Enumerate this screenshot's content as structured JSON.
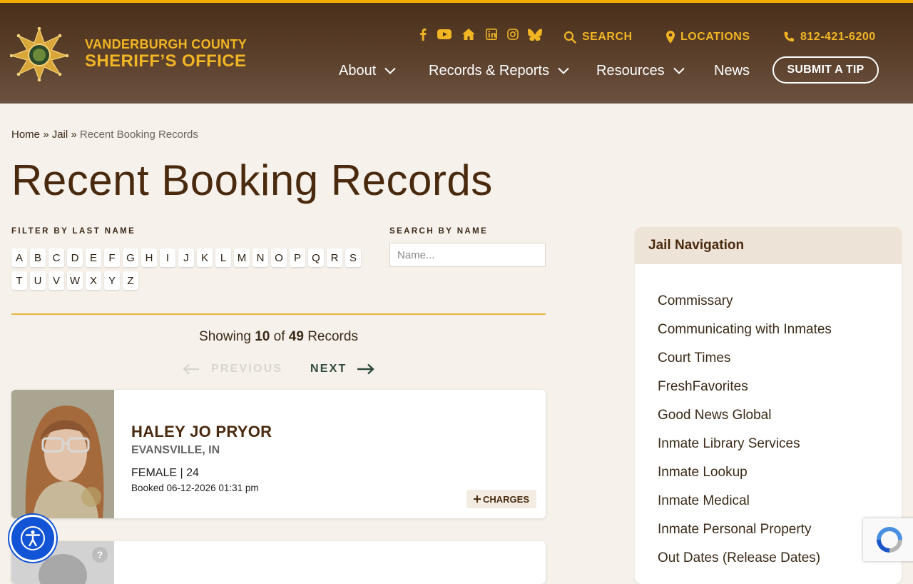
{
  "site": {
    "brand_line1": "VANDERBURGH COUNTY",
    "brand_line2": "SHERIFF’S OFFICE",
    "accent": "#f2b524",
    "header_bg": "#4a2f1b"
  },
  "social_icons": [
    "facebook-icon",
    "youtube-icon",
    "home-icon",
    "linkedin-icon",
    "instagram-icon",
    "bluesky-icon"
  ],
  "utility": {
    "search_label": "SEARCH",
    "locations_label": "LOCATIONS",
    "phone": "812-421-6200"
  },
  "nav": {
    "about": "About",
    "records": "Records & Reports",
    "resources": "Resources",
    "news": "News",
    "tip": "SUBMIT A TIP"
  },
  "breadcrumb": {
    "home": "Home",
    "sep1": "»",
    "jail": "Jail",
    "sep2": "»",
    "current": "Recent Booking Records"
  },
  "page_title": "Recent Booking Records",
  "filter": {
    "label": "FILTER BY LAST NAME",
    "letters": [
      "A",
      "B",
      "C",
      "D",
      "E",
      "F",
      "G",
      "H",
      "I",
      "J",
      "K",
      "L",
      "M",
      "N",
      "O",
      "P",
      "Q",
      "R",
      "S",
      "T",
      "U",
      "V",
      "W",
      "X",
      "Y",
      "Z"
    ]
  },
  "search": {
    "label": "SEARCH BY NAME",
    "placeholder": "Name..."
  },
  "results": {
    "prefix": "Showing",
    "shown": "10",
    "of": "of",
    "total": "49",
    "suffix": "Records",
    "prev_label": "PREVIOUS",
    "next_label": "NEXT"
  },
  "records": [
    {
      "name": "HALEY JO PRYOR",
      "city": "EVANSVILLE, IN",
      "gender_age": "FEMALE | 24",
      "booked": "Booked 06-12-2026 01:31 pm",
      "charges_label": "CHARGES"
    }
  ],
  "sidebar": {
    "title": "Jail Navigation",
    "links": [
      "Commissary",
      "Communicating with Inmates",
      "Court Times",
      "FreshFavorites",
      "Good News Global",
      "Inmate Library Services",
      "Inmate Lookup",
      "Inmate Medical",
      "Inmate Personal Property",
      "Out Dates (Release Dates)"
    ]
  }
}
